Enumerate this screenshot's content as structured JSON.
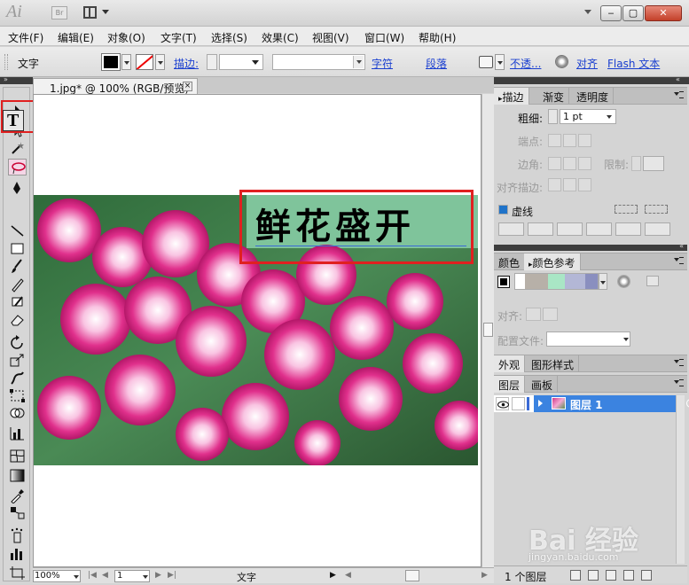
{
  "app": {
    "logo": "Ai",
    "bridge": "Br"
  },
  "menu": [
    "文件(F)",
    "编辑(E)",
    "对象(O)",
    "文字(T)",
    "选择(S)",
    "效果(C)",
    "视图(V)",
    "窗口(W)",
    "帮助(H)"
  ],
  "control_bar": {
    "tool_label": "文字",
    "stroke_link": "描边:",
    "character_link": "字符",
    "paragraph_link": "段落",
    "opacity_link": "不透...",
    "align_link": "对齐",
    "flash_link": "Flash 文本"
  },
  "document": {
    "tab_label": "1.jpg* @ 100% (RGB/预览)",
    "close_glyph": "×",
    "headline": "鲜花盛开"
  },
  "status": {
    "zoom": "100%",
    "page": "1",
    "tool": "文字"
  },
  "stroke_panel": {
    "tabs": [
      "描边",
      "渐变",
      "透明度"
    ],
    "weight_label": "粗细:",
    "weight_value": "1 pt",
    "cap_label": "端点:",
    "corner_label": "边角:",
    "limit_label": "限制:",
    "align_stroke_label": "对齐描边:",
    "dashed_label": "虚线"
  },
  "color_panel": {
    "tabs": [
      "颜色",
      "颜色参考"
    ]
  },
  "arrow_panel": {
    "align_label": "对齐:",
    "profile_label": "配置文件:"
  },
  "appearance_panel": {
    "tabs": [
      "外观",
      "图形样式"
    ]
  },
  "layers_panel": {
    "tabs": [
      "图层",
      "画板"
    ],
    "layer_name": "图层 1",
    "count": "1 个图层"
  },
  "watermark": {
    "logo": "Bai 经验",
    "sub": "jingyan.baidu.com"
  },
  "colors": {
    "selection": "#3b83e0",
    "highlight": "#e02020",
    "link": "#1a3fd0"
  }
}
